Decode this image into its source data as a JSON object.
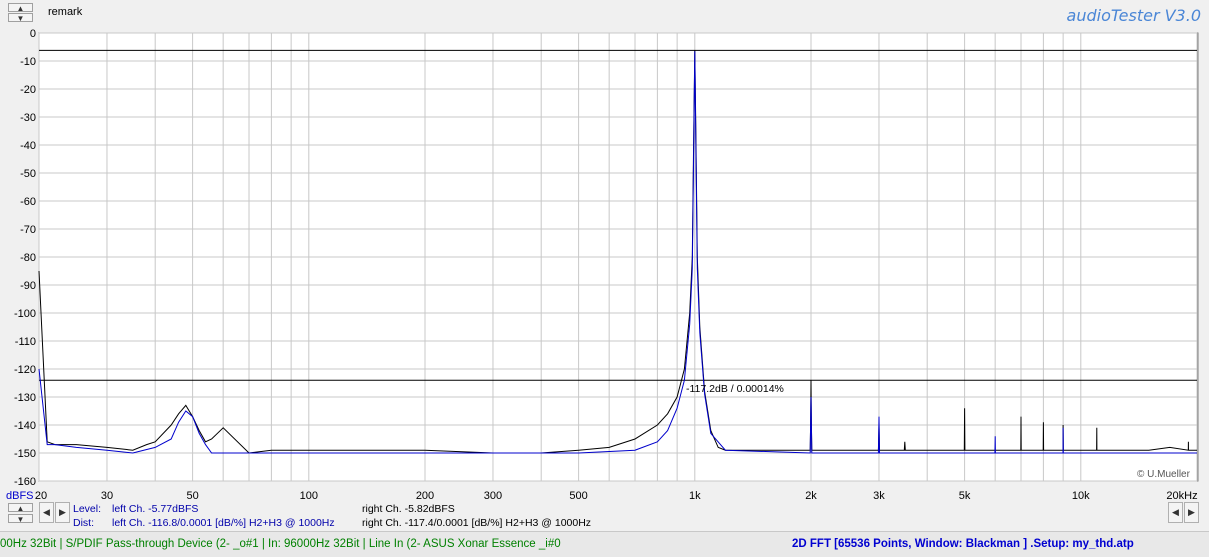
{
  "header": {
    "remark": "remark",
    "brand": "audioTester  V3.0"
  },
  "chart_data": {
    "type": "line",
    "title": "",
    "xlabel": "",
    "ylabel": "dBFS",
    "x_scale": "log",
    "xlim": [
      20,
      20000
    ],
    "ylim": [
      -160,
      0
    ],
    "x_ticks": [
      {
        "v": 20,
        "label": "20"
      },
      {
        "v": 30,
        "label": "30"
      },
      {
        "v": 50,
        "label": "50"
      },
      {
        "v": 100,
        "label": "100"
      },
      {
        "v": 200,
        "label": "200"
      },
      {
        "v": 300,
        "label": "300"
      },
      {
        "v": 500,
        "label": "500"
      },
      {
        "v": 1000,
        "label": "1k"
      },
      {
        "v": 2000,
        "label": "2k"
      },
      {
        "v": 3000,
        "label": "3k"
      },
      {
        "v": 5000,
        "label": "5k"
      },
      {
        "v": 10000,
        "label": "10k"
      },
      {
        "v": 20000,
        "label": "20kHz"
      }
    ],
    "y_ticks": [
      0,
      -10,
      -20,
      -30,
      -40,
      -50,
      -60,
      -70,
      -80,
      -90,
      -100,
      -110,
      -120,
      -130,
      -140,
      -150,
      -160
    ],
    "y_axis_label": "dBFS",
    "grid": true,
    "reference_lines": [
      {
        "y": -6.2,
        "label": ""
      },
      {
        "y": -124,
        "label": "-117.2dB / 0.00014%"
      }
    ],
    "copyright": "© U.Mueller",
    "series": [
      {
        "color": "#000000",
        "x": [
          20,
          21,
          22,
          25,
          30,
          35,
          38,
          40,
          44,
          46,
          48,
          50,
          52,
          54,
          56,
          60,
          70,
          80,
          100,
          150,
          200,
          300,
          400,
          500,
          600,
          700,
          800,
          850,
          900,
          940,
          970,
          985,
          993,
          1000,
          1007,
          1015,
          1030,
          1060,
          1100,
          1150,
          1200,
          1500,
          1990,
          1995,
          2000,
          2005,
          2010,
          2500,
          2990,
          3000,
          3010,
          3490,
          3500,
          3510,
          4990,
          5000,
          5010,
          6990,
          7000,
          7010,
          7990,
          8000,
          8010,
          8990,
          9000,
          9010,
          10990,
          11000,
          11010,
          15000,
          17000,
          18990,
          19000,
          19010,
          20000
        ],
        "y": [
          -85,
          -146,
          -147,
          -147,
          -148,
          -149,
          -147,
          -146,
          -140,
          -136,
          -133,
          -137,
          -142,
          -146,
          -145,
          -141,
          -150,
          -149,
          -149,
          -149,
          -149,
          -150,
          -150,
          -149,
          -148,
          -145,
          -140,
          -136,
          -130,
          -120,
          -100,
          -80,
          -40,
          -6.2,
          -40,
          -80,
          -105,
          -128,
          -142,
          -148,
          -149,
          -149,
          -149,
          -140,
          -124,
          -140,
          -149,
          -149,
          -149,
          -140,
          -149,
          -149,
          -146,
          -149,
          -149,
          -134,
          -149,
          -149,
          -137,
          -149,
          -149,
          -139,
          -149,
          -149,
          -140,
          -149,
          -149,
          -141,
          -149,
          -149,
          -148,
          -149,
          -146,
          -149,
          -149
        ]
      },
      {
        "color": "#0000cc",
        "x": [
          20,
          21,
          22,
          25,
          30,
          35,
          40,
          44,
          46,
          48,
          50,
          52,
          54,
          56,
          60,
          70,
          100,
          200,
          300,
          500,
          700,
          800,
          850,
          900,
          940,
          970,
          985,
          993,
          1000,
          1007,
          1015,
          1030,
          1060,
          1100,
          1200,
          1990,
          2000,
          2010,
          2990,
          3000,
          3010,
          5990,
          6000,
          6010,
          8990,
          9000,
          9010,
          20000
        ],
        "y": [
          -120,
          -147,
          -147,
          -148,
          -149,
          -150,
          -148,
          -145,
          -139,
          -135,
          -137,
          -143,
          -147,
          -150,
          -150,
          -150,
          -150,
          -150,
          -150,
          -150,
          -149,
          -146,
          -142,
          -134,
          -124,
          -104,
          -84,
          -44,
          -6.5,
          -44,
          -84,
          -107,
          -129,
          -143,
          -149,
          -150,
          -130,
          -150,
          -150,
          -137,
          -150,
          -150,
          -144,
          -150,
          -150,
          -141,
          -150,
          -150
        ]
      }
    ]
  },
  "info": {
    "level_label": "Level:",
    "dist_label": "Dist:",
    "level_left": "left Ch. -5.77dBFS",
    "level_right": "right Ch. -5.82dBFS",
    "dist_left": "left Ch. -116.8/0.0001 [dB/%] H2+H3 @ 1000Hz",
    "dist_right": "right Ch. -117.4/0.0001 [dB/%] H2+H3 @ 1000Hz"
  },
  "status": {
    "left": "00Hz 32Bit  | S/PDIF Pass-through Device (2- _o#1  | In: 96000Hz 32Bit  | Line In (2- ASUS Xonar Essence _i#0",
    "right": "2D FFT [65536 Points, Window: Blackman ]  .Setup: my_thd.atp"
  },
  "icons": {
    "up": "▲",
    "down": "▼",
    "left": "◀",
    "right": "▶"
  }
}
